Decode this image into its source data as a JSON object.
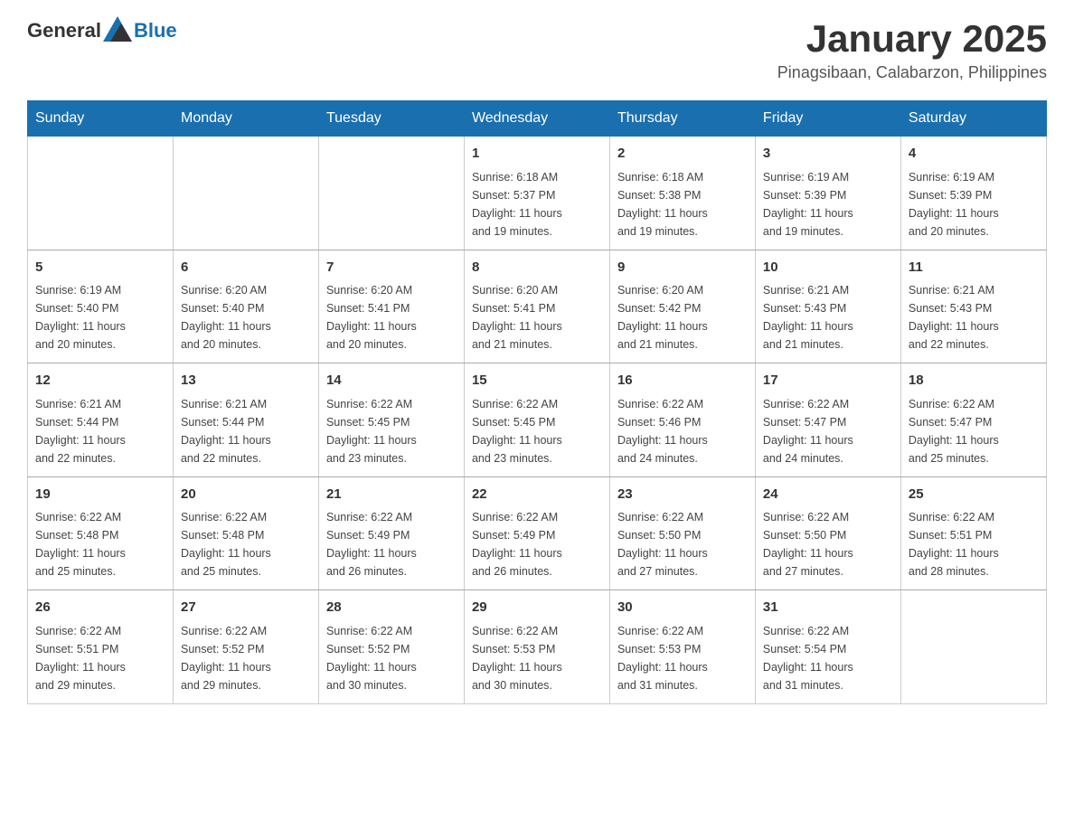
{
  "header": {
    "logo": {
      "general": "General",
      "blue": "Blue"
    },
    "title": "January 2025",
    "location": "Pinagsibaan, Calabarzon, Philippines"
  },
  "calendar": {
    "weekdays": [
      "Sunday",
      "Monday",
      "Tuesday",
      "Wednesday",
      "Thursday",
      "Friday",
      "Saturday"
    ],
    "weeks": [
      [
        {
          "day": "",
          "info": ""
        },
        {
          "day": "",
          "info": ""
        },
        {
          "day": "",
          "info": ""
        },
        {
          "day": "1",
          "info": "Sunrise: 6:18 AM\nSunset: 5:37 PM\nDaylight: 11 hours\nand 19 minutes."
        },
        {
          "day": "2",
          "info": "Sunrise: 6:18 AM\nSunset: 5:38 PM\nDaylight: 11 hours\nand 19 minutes."
        },
        {
          "day": "3",
          "info": "Sunrise: 6:19 AM\nSunset: 5:39 PM\nDaylight: 11 hours\nand 19 minutes."
        },
        {
          "day": "4",
          "info": "Sunrise: 6:19 AM\nSunset: 5:39 PM\nDaylight: 11 hours\nand 20 minutes."
        }
      ],
      [
        {
          "day": "5",
          "info": "Sunrise: 6:19 AM\nSunset: 5:40 PM\nDaylight: 11 hours\nand 20 minutes."
        },
        {
          "day": "6",
          "info": "Sunrise: 6:20 AM\nSunset: 5:40 PM\nDaylight: 11 hours\nand 20 minutes."
        },
        {
          "day": "7",
          "info": "Sunrise: 6:20 AM\nSunset: 5:41 PM\nDaylight: 11 hours\nand 20 minutes."
        },
        {
          "day": "8",
          "info": "Sunrise: 6:20 AM\nSunset: 5:41 PM\nDaylight: 11 hours\nand 21 minutes."
        },
        {
          "day": "9",
          "info": "Sunrise: 6:20 AM\nSunset: 5:42 PM\nDaylight: 11 hours\nand 21 minutes."
        },
        {
          "day": "10",
          "info": "Sunrise: 6:21 AM\nSunset: 5:43 PM\nDaylight: 11 hours\nand 21 minutes."
        },
        {
          "day": "11",
          "info": "Sunrise: 6:21 AM\nSunset: 5:43 PM\nDaylight: 11 hours\nand 22 minutes."
        }
      ],
      [
        {
          "day": "12",
          "info": "Sunrise: 6:21 AM\nSunset: 5:44 PM\nDaylight: 11 hours\nand 22 minutes."
        },
        {
          "day": "13",
          "info": "Sunrise: 6:21 AM\nSunset: 5:44 PM\nDaylight: 11 hours\nand 22 minutes."
        },
        {
          "day": "14",
          "info": "Sunrise: 6:22 AM\nSunset: 5:45 PM\nDaylight: 11 hours\nand 23 minutes."
        },
        {
          "day": "15",
          "info": "Sunrise: 6:22 AM\nSunset: 5:45 PM\nDaylight: 11 hours\nand 23 minutes."
        },
        {
          "day": "16",
          "info": "Sunrise: 6:22 AM\nSunset: 5:46 PM\nDaylight: 11 hours\nand 24 minutes."
        },
        {
          "day": "17",
          "info": "Sunrise: 6:22 AM\nSunset: 5:47 PM\nDaylight: 11 hours\nand 24 minutes."
        },
        {
          "day": "18",
          "info": "Sunrise: 6:22 AM\nSunset: 5:47 PM\nDaylight: 11 hours\nand 25 minutes."
        }
      ],
      [
        {
          "day": "19",
          "info": "Sunrise: 6:22 AM\nSunset: 5:48 PM\nDaylight: 11 hours\nand 25 minutes."
        },
        {
          "day": "20",
          "info": "Sunrise: 6:22 AM\nSunset: 5:48 PM\nDaylight: 11 hours\nand 25 minutes."
        },
        {
          "day": "21",
          "info": "Sunrise: 6:22 AM\nSunset: 5:49 PM\nDaylight: 11 hours\nand 26 minutes."
        },
        {
          "day": "22",
          "info": "Sunrise: 6:22 AM\nSunset: 5:49 PM\nDaylight: 11 hours\nand 26 minutes."
        },
        {
          "day": "23",
          "info": "Sunrise: 6:22 AM\nSunset: 5:50 PM\nDaylight: 11 hours\nand 27 minutes."
        },
        {
          "day": "24",
          "info": "Sunrise: 6:22 AM\nSunset: 5:50 PM\nDaylight: 11 hours\nand 27 minutes."
        },
        {
          "day": "25",
          "info": "Sunrise: 6:22 AM\nSunset: 5:51 PM\nDaylight: 11 hours\nand 28 minutes."
        }
      ],
      [
        {
          "day": "26",
          "info": "Sunrise: 6:22 AM\nSunset: 5:51 PM\nDaylight: 11 hours\nand 29 minutes."
        },
        {
          "day": "27",
          "info": "Sunrise: 6:22 AM\nSunset: 5:52 PM\nDaylight: 11 hours\nand 29 minutes."
        },
        {
          "day": "28",
          "info": "Sunrise: 6:22 AM\nSunset: 5:52 PM\nDaylight: 11 hours\nand 30 minutes."
        },
        {
          "day": "29",
          "info": "Sunrise: 6:22 AM\nSunset: 5:53 PM\nDaylight: 11 hours\nand 30 minutes."
        },
        {
          "day": "30",
          "info": "Sunrise: 6:22 AM\nSunset: 5:53 PM\nDaylight: 11 hours\nand 31 minutes."
        },
        {
          "day": "31",
          "info": "Sunrise: 6:22 AM\nSunset: 5:54 PM\nDaylight: 11 hours\nand 31 minutes."
        },
        {
          "day": "",
          "info": ""
        }
      ]
    ]
  }
}
